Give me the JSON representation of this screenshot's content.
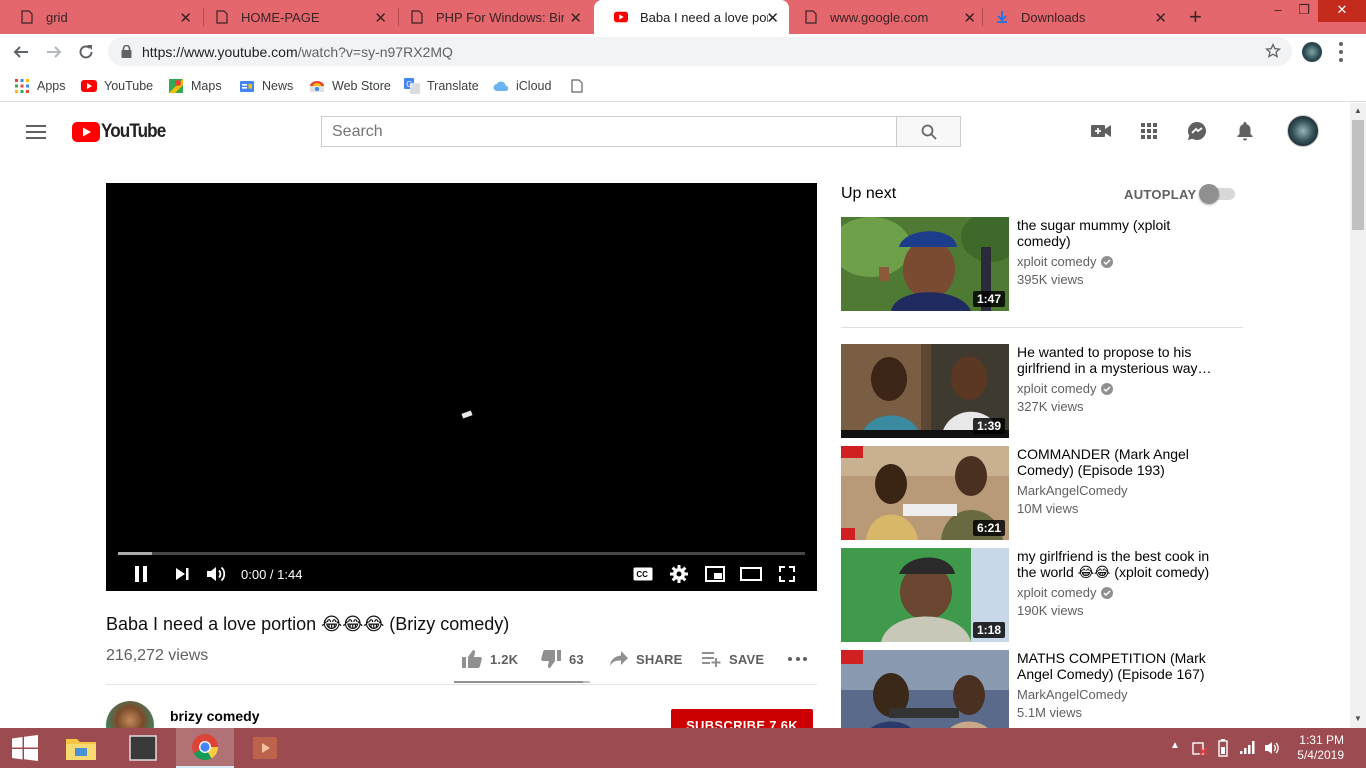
{
  "browser": {
    "tabs": [
      {
        "title": "grid",
        "icon": "page-icon",
        "active": false
      },
      {
        "title": "HOME-PAGE",
        "icon": "page-icon",
        "active": false
      },
      {
        "title": "PHP For Windows: Binari",
        "icon": "page-icon",
        "active": false
      },
      {
        "title": "Baba I need a love portio",
        "icon": "youtube-icon",
        "active": true
      },
      {
        "title": "www.google.com",
        "icon": "page-icon",
        "active": false
      },
      {
        "title": "Downloads",
        "icon": "download-icon",
        "active": false
      }
    ],
    "url_host": "https://www.youtube.com",
    "url_path": "/watch?v=sy-n97RX2MQ",
    "bookmarks": [
      {
        "label": "Apps",
        "icon": "apps-grid-icon"
      },
      {
        "label": "YouTube",
        "icon": "youtube-icon"
      },
      {
        "label": "Maps",
        "icon": "maps-icon"
      },
      {
        "label": "News",
        "icon": "news-icon"
      },
      {
        "label": "Web Store",
        "icon": "web-store-icon"
      },
      {
        "label": "Translate",
        "icon": "translate-icon"
      },
      {
        "label": "iCloud",
        "icon": "icloud-icon"
      }
    ]
  },
  "youtube": {
    "logo_text": "YouTube",
    "search_placeholder": "Search",
    "colors": {
      "brand_red": "#ff0000",
      "subscribe_red": "#cc0000"
    }
  },
  "player": {
    "time_display": "0:00 / 1:44",
    "progress_fraction": 0.05
  },
  "video": {
    "title": "Baba I need a love portion 😂😂😂 (Brizy comedy)",
    "views": "216,272 views",
    "likes": "1.2K",
    "dislikes": "63",
    "share_label": "SHARE",
    "save_label": "SAVE",
    "like_ratio": 0.95
  },
  "channel": {
    "name": "brizy comedy",
    "subscribe_label": "SUBSCRIBE",
    "subscriber_count": "7.6K"
  },
  "sidebar": {
    "up_next_label": "Up next",
    "autoplay_label": "AUTOPLAY",
    "autoplay_on": false,
    "recommendations": [
      {
        "title": "the sugar mummy (xploit comedy)",
        "channel": "xploit comedy",
        "verified": true,
        "views": "395K views",
        "duration": "1:47",
        "thumb_color": "#4f7a3a"
      },
      {
        "title": "He wanted to propose to his girlfriend in a mysterious way…",
        "channel": "xploit comedy",
        "verified": true,
        "views": "327K views",
        "duration": "1:39",
        "thumb_color": "#6b4a3a"
      },
      {
        "title": "COMMANDER (Mark Angel Comedy) (Episode 193)",
        "channel": "MarkAngelComedy",
        "verified": false,
        "views": "10M views",
        "duration": "6:21",
        "thumb_color": "#8a6a4a"
      },
      {
        "title": "my girlfriend is the best cook in the world 😂😂 (xploit comedy)",
        "channel": "xploit comedy",
        "verified": true,
        "views": "190K views",
        "duration": "1:18",
        "thumb_color": "#3e8f4a"
      },
      {
        "title": "MATHS COMPETITION (Mark Angel Comedy) (Episode 167)",
        "channel": "MarkAngelComedy",
        "verified": false,
        "views": "5.1M views",
        "duration": "",
        "thumb_color": "#3a5a8a"
      }
    ]
  },
  "taskbar": {
    "time": "1:31 PM",
    "date": "5/4/2019"
  }
}
